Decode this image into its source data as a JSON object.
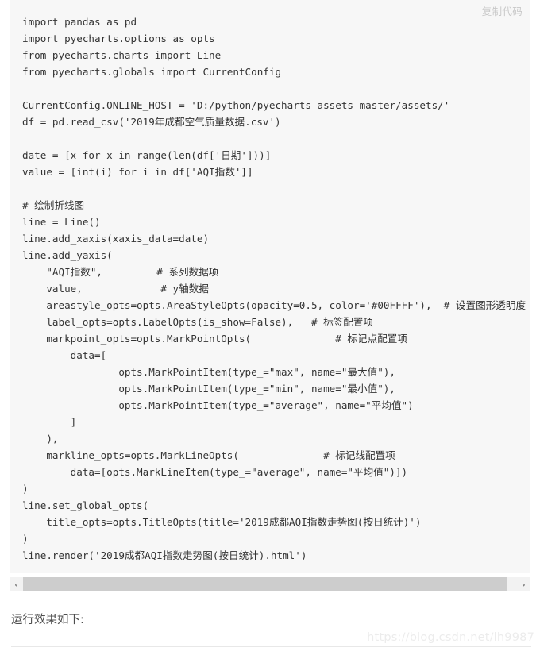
{
  "code_block": {
    "copy_label": "复制代码",
    "language": "python",
    "lines": [
      "import pandas as pd",
      "import pyecharts.options as opts",
      "from pyecharts.charts import Line",
      "from pyecharts.globals import CurrentConfig",
      "",
      "CurrentConfig.ONLINE_HOST = 'D:/python/pyecharts-assets-master/assets/'",
      "df = pd.read_csv('2019年成都空气质量数据.csv')",
      "",
      "date = [x for x in range(len(df['日期']))]",
      "value = [int(i) for i in df['AQI指数']]",
      "",
      "# 绘制折线图",
      "line = Line()",
      "line.add_xaxis(xaxis_data=date)",
      "line.add_yaxis(",
      "    \"AQI指数\",         # 系列数据项",
      "    value,             # y轴数据",
      "    areastyle_opts=opts.AreaStyleOpts(opacity=0.5, color='#00FFFF'),  # 设置图形透明度  填充颜色",
      "    label_opts=opts.LabelOpts(is_show=False),   # 标签配置项",
      "    markpoint_opts=opts.MarkPointOpts(              # 标记点配置项",
      "        data=[",
      "                opts.MarkPointItem(type_=\"max\", name=\"最大值\"),",
      "                opts.MarkPointItem(type_=\"min\", name=\"最小值\"),",
      "                opts.MarkPointItem(type_=\"average\", name=\"平均值\")",
      "        ]",
      "    ),",
      "    markline_opts=opts.MarkLineOpts(              # 标记线配置项",
      "        data=[opts.MarkLineItem(type_=\"average\", name=\"平均值\")])",
      ")",
      "line.set_global_opts(",
      "    title_opts=opts.TitleOpts(title='2019成都AQI指数走势图(按日统计)')",
      ")",
      "line.render('2019成都AQI指数走势图(按日统计).html')"
    ]
  },
  "scrollbar": {
    "left_arrow": "‹",
    "right_arrow": "›"
  },
  "article": {
    "result_caption": "运行效果如下:",
    "watermark": "https://blog.csdn.net/lh9987"
  }
}
